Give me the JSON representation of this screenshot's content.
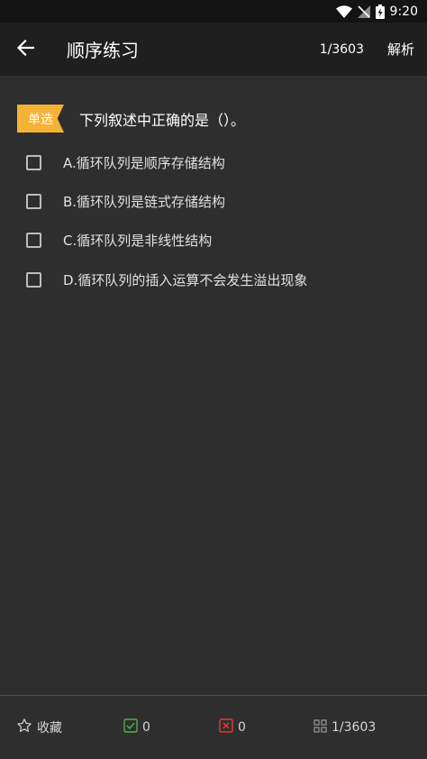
{
  "status_bar": {
    "time": "9:20"
  },
  "app_bar": {
    "title": "顺序练习",
    "progress": "1/3603",
    "analysis_label": "解析"
  },
  "question": {
    "type_badge": "单选",
    "text": "下列叙述中正确的是（）。",
    "options": [
      {
        "label": "A.循环队列是顺序存储结构"
      },
      {
        "label": "B.循环队列是链式存储结构"
      },
      {
        "label": "C.循环队列是非线性结构"
      },
      {
        "label": "D.循环队列的插入运算不会发生溢出现象"
      }
    ]
  },
  "bottom_bar": {
    "favorite_label": "收藏",
    "correct_count": "0",
    "wrong_count": "0",
    "position": "1/3603"
  },
  "colors": {
    "badge": "#f5b335",
    "correct": "#4caf50",
    "wrong": "#e53935",
    "background": "#2e2e2e",
    "app_bar": "#1f1f1f"
  }
}
